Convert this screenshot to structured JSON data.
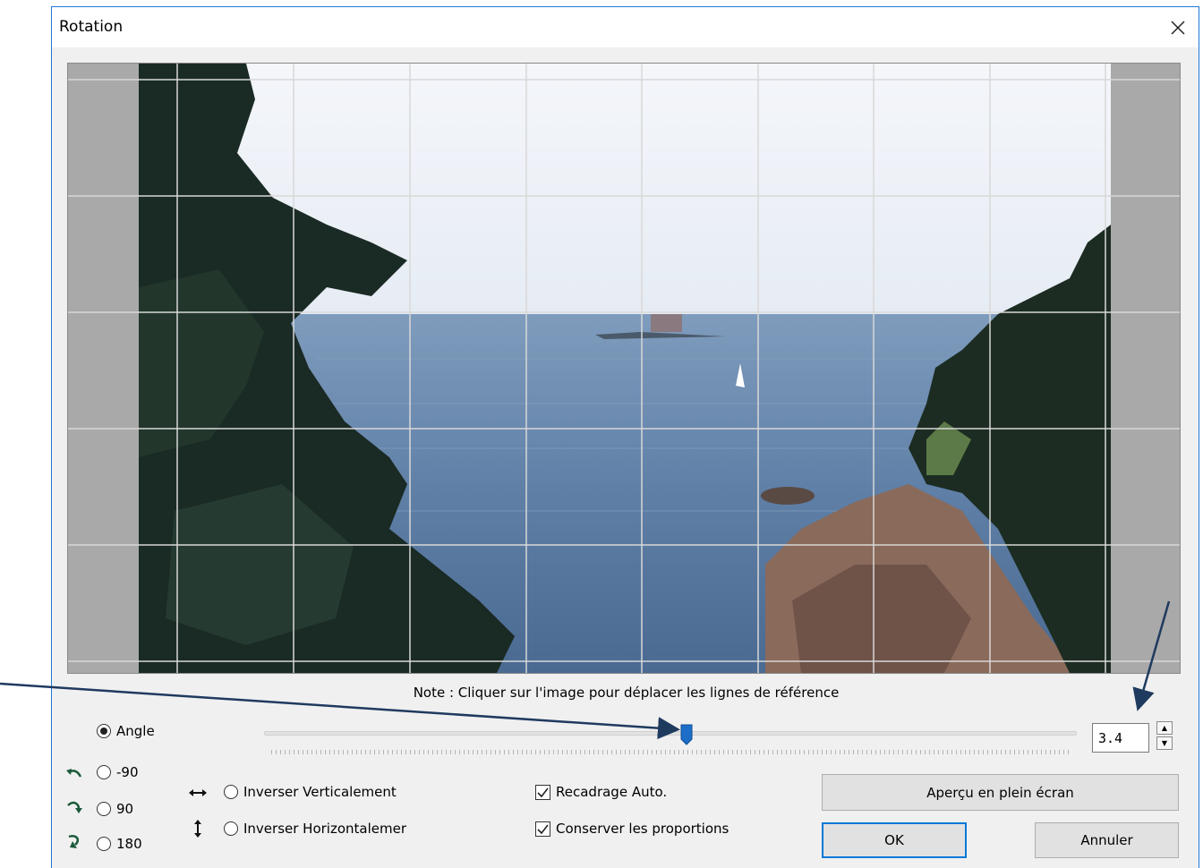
{
  "dialog": {
    "title": "Rotation",
    "note": "Note : Cliquer sur l'image pour déplacer les lignes de référence"
  },
  "angle": {
    "label": "Angle",
    "selected": true,
    "value": "3.4",
    "slider_position": 0.52
  },
  "rotate_presets": [
    {
      "label": "-90",
      "icon": "rotate-left-icon"
    },
    {
      "label": "90",
      "icon": "rotate-right-icon"
    },
    {
      "label": "180",
      "icon": "rotate-180-icon"
    }
  ],
  "flip": {
    "vertical_label": "Inverser Verticalement",
    "horizontal_label": "Inverser Horizontalemer"
  },
  "options": {
    "auto_crop_label": "Recadrage Auto.",
    "auto_crop_checked": true,
    "keep_ratio_label": "Conserver les proportions",
    "keep_ratio_checked": true
  },
  "buttons": {
    "fullscreen": "Aperçu en plein écran",
    "ok": "OK",
    "cancel": "Annuler"
  },
  "colors": {
    "annotation_arrow": "#1f3a5f",
    "slider_thumb": "#1c6ec8",
    "default_button_border": "#0078d7"
  }
}
